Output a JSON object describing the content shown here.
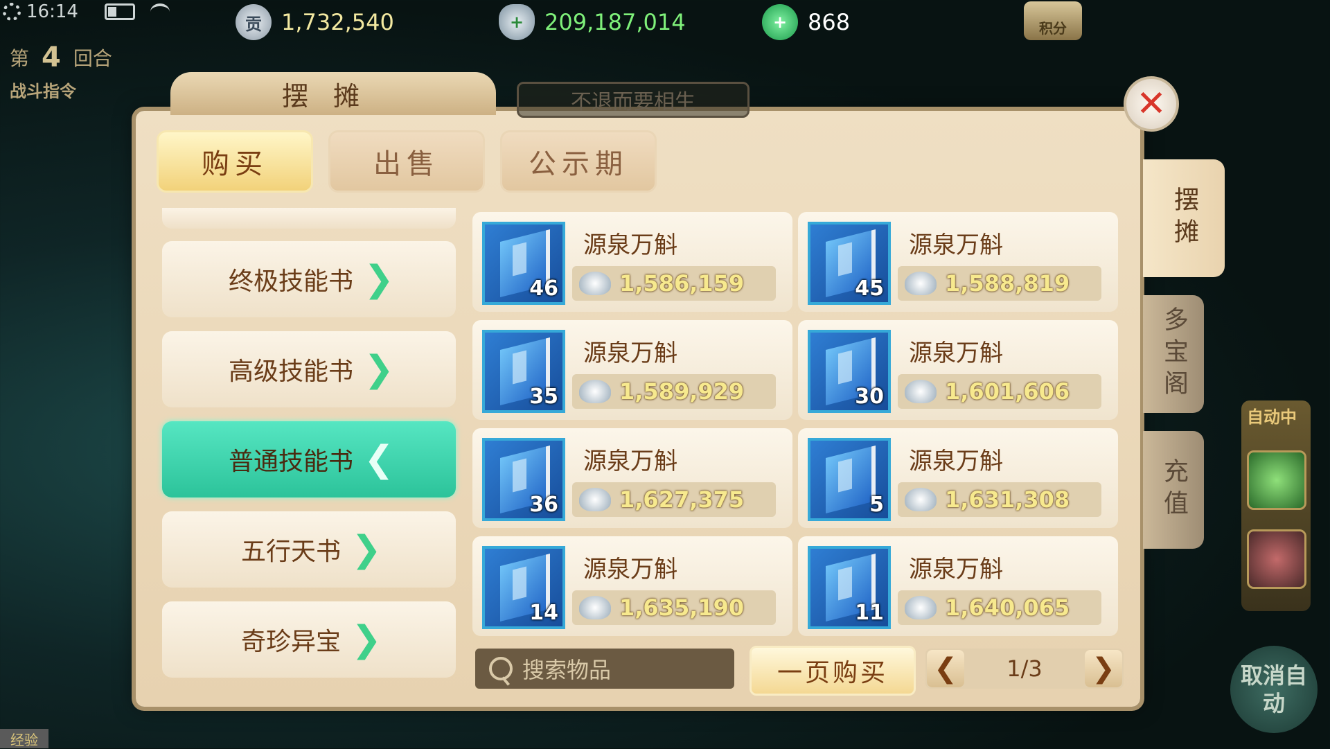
{
  "status": {
    "time": "16:14"
  },
  "round": {
    "prefix": "第",
    "number": "4",
    "suffix": "回合",
    "battle_command": "战斗指令"
  },
  "currency": {
    "silver": {
      "icon": "silver-coin-icon",
      "glyph": "贡",
      "value": "1,732,540"
    },
    "ingot": {
      "icon": "silver-ingot-plus-icon",
      "glyph": "+",
      "value": "209,187,014"
    },
    "jade": {
      "icon": "jade-plus-icon",
      "glyph": "+",
      "value": "868"
    },
    "points": {
      "label": "积分"
    }
  },
  "panel": {
    "title": "摆摊",
    "ghost_tab": "不退而要相生",
    "close": "✕"
  },
  "tabs": [
    {
      "label": "购买",
      "active": true
    },
    {
      "label": "出售",
      "active": false
    },
    {
      "label": "公示期",
      "active": false
    }
  ],
  "side_tabs": [
    {
      "label": "摆摊",
      "active": true
    },
    {
      "label": "多宝阁",
      "active": false
    },
    {
      "label": "充值",
      "active": false
    }
  ],
  "categories": [
    {
      "label": "终极技能书",
      "active": false,
      "chevron": "❯"
    },
    {
      "label": "高级技能书",
      "active": false,
      "chevron": "❯"
    },
    {
      "label": "普通技能书",
      "active": true,
      "chevron": "❮"
    },
    {
      "label": "五行天书",
      "active": false,
      "chevron": "❯"
    },
    {
      "label": "奇珍异宝",
      "active": false,
      "chevron": "❯"
    }
  ],
  "items": [
    {
      "name": "源泉万斛",
      "qty": "46",
      "price": "1,586,159"
    },
    {
      "name": "源泉万斛",
      "qty": "45",
      "price": "1,588,819"
    },
    {
      "name": "源泉万斛",
      "qty": "35",
      "price": "1,589,929"
    },
    {
      "name": "源泉万斛",
      "qty": "30",
      "price": "1,601,606"
    },
    {
      "name": "源泉万斛",
      "qty": "36",
      "price": "1,627,375"
    },
    {
      "name": "源泉万斛",
      "qty": "5",
      "price": "1,631,308"
    },
    {
      "name": "源泉万斛",
      "qty": "14",
      "price": "1,635,190"
    },
    {
      "name": "源泉万斛",
      "qty": "11",
      "price": "1,640,065"
    }
  ],
  "search": {
    "placeholder": "搜索物品"
  },
  "buy_page": "一页购买",
  "pager": {
    "prev": "❮",
    "next": "❯",
    "text": "1/3"
  },
  "auto": {
    "label": "自动中",
    "cancel": "取消自动"
  },
  "exp_label": "经验",
  "colors": {
    "accent_teal": "#2cc39a",
    "price_gold": "#f7e98e",
    "close_red": "#d8362a"
  }
}
